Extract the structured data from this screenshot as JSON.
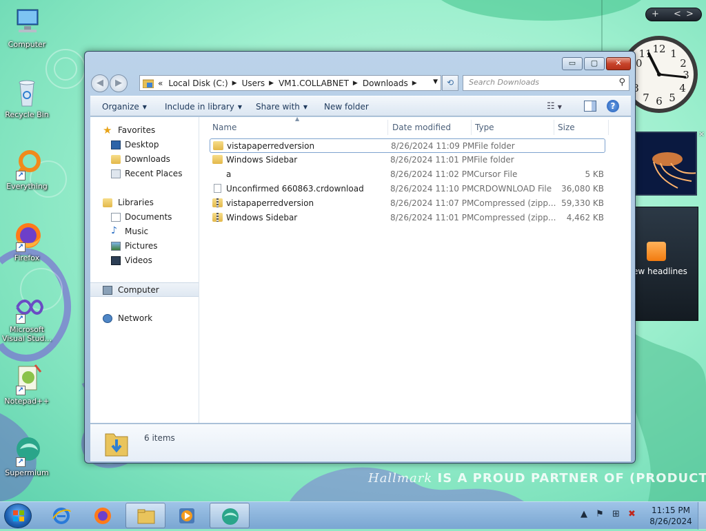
{
  "desktop": {
    "icons": [
      {
        "label": "Computer"
      },
      {
        "label": "Recycle Bin"
      },
      {
        "label": "Everything"
      },
      {
        "label": "Firefox"
      },
      {
        "label": "Microsoft Visual Stud..."
      },
      {
        "label": "Notepad++"
      },
      {
        "label": "Supermium"
      }
    ],
    "banner": {
      "brand": "Hallmark",
      "text": "IS A PROUD PARTNER OF (PRODUCT)"
    }
  },
  "gadgets": {
    "bar": {
      "add": "+",
      "prev": "<",
      "next": ">"
    },
    "clock": {
      "numerals": [
        "12",
        "1",
        "2",
        "3",
        "4",
        "5",
        "6",
        "7",
        "8",
        "9",
        "10",
        "11"
      ]
    },
    "feed": {
      "label": "ew headlines"
    },
    "close": "×"
  },
  "window": {
    "caption": {
      "minimize": "▭",
      "maximize": "▢",
      "close": "✕"
    },
    "nav": {
      "back": "◀",
      "forward": "▶"
    },
    "address": {
      "overflow": "«",
      "crumbs": [
        "Local Disk (C:)",
        "Users",
        "VM1.COLLABNET",
        "Downloads"
      ],
      "separator": "▶"
    },
    "search": {
      "placeholder": "Search Downloads",
      "icon": "⚲"
    },
    "toolbar": {
      "organize": "Organize",
      "include_in_library": "Include in library",
      "share_with": "Share with",
      "new_folder": "New folder",
      "help": "?"
    },
    "nav_pane": {
      "favorites": "Favorites",
      "desktop": "Desktop",
      "downloads": "Downloads",
      "recent_places": "Recent Places",
      "libraries": "Libraries",
      "documents": "Documents",
      "music": "Music",
      "pictures": "Pictures",
      "videos": "Videos",
      "computer": "Computer",
      "network": "Network"
    },
    "columns": {
      "name": "Name",
      "date": "Date modified",
      "type": "Type",
      "size": "Size"
    },
    "files": [
      {
        "name": "vistapaperredversion",
        "date": "8/26/2024 11:09 PM",
        "type": "File folder",
        "size": "",
        "icon": "folder"
      },
      {
        "name": "Windows Sidebar",
        "date": "8/26/2024 11:01 PM",
        "type": "File folder",
        "size": "",
        "icon": "folder"
      },
      {
        "name": "a",
        "date": "8/26/2024 11:02 PM",
        "type": "Cursor File",
        "size": "5 KB",
        "icon": "cursor"
      },
      {
        "name": "Unconfirmed 660863.crdownload",
        "date": "8/26/2024 11:10 PM",
        "type": "CRDOWNLOAD File",
        "size": "36,080 KB",
        "icon": "file"
      },
      {
        "name": "vistapaperredversion",
        "date": "8/26/2024 11:07 PM",
        "type": "Compressed (zipp...",
        "size": "59,330 KB",
        "icon": "zip"
      },
      {
        "name": "Windows Sidebar",
        "date": "8/26/2024 11:01 PM",
        "type": "Compressed (zipp...",
        "size": "4,462 KB",
        "icon": "zip"
      }
    ],
    "details": {
      "count": "6 items"
    }
  },
  "taskbar": {
    "clock": {
      "time": "11:15 PM",
      "date": "8/26/2024"
    }
  },
  "colors": {
    "desktop_bg": "#8fe8c4",
    "window_glass": "#a9c3de",
    "selection_border": "#7da2ce",
    "taskbar": "#8eb6dd"
  }
}
